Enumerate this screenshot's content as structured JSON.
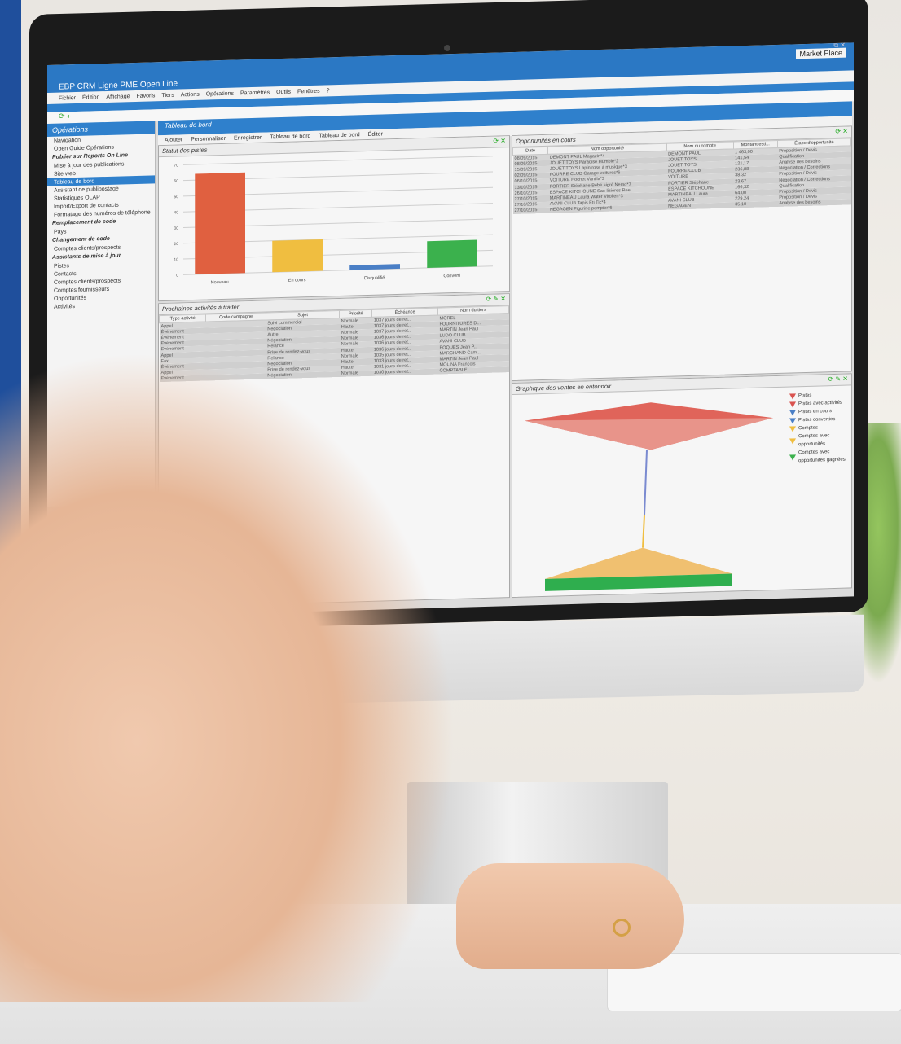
{
  "window": {
    "title": "EBP CRM Ligne PME Open Line",
    "market_place": "Market Place",
    "controls": "_ ⧉ ✕"
  },
  "menu": [
    "Fichier",
    "Édition",
    "Affichage",
    "Favoris",
    "Tiers",
    "Actions",
    "Opérations",
    "Paramètres",
    "Outils",
    "Fenêtres",
    "?"
  ],
  "sidebar": {
    "title": "Opérations",
    "section": "Navigation",
    "items": [
      {
        "label": "Open Guide Opérations",
        "type": "item"
      },
      {
        "label": "Publier sur Reports On Line",
        "type": "group"
      },
      {
        "label": "Mise à jour des publications",
        "type": "item"
      },
      {
        "label": "Site web",
        "type": "item"
      },
      {
        "label": "Tableau de bord",
        "type": "selected"
      },
      {
        "label": "Assistant de publipostage",
        "type": "item"
      },
      {
        "label": "Statistiques OLAP",
        "type": "item"
      },
      {
        "label": "Import/Export de contacts",
        "type": "item"
      },
      {
        "label": "Formatage des numéros de téléphone",
        "type": "item"
      },
      {
        "label": "Remplacement de code",
        "type": "group"
      },
      {
        "label": "Pays",
        "type": "item"
      },
      {
        "label": "Changement de code",
        "type": "group"
      },
      {
        "label": "Comptes clients/prospects",
        "type": "item"
      },
      {
        "label": "Assistants de mise à jour",
        "type": "group"
      },
      {
        "label": "Pistes",
        "type": "item"
      },
      {
        "label": "Contacts",
        "type": "item"
      },
      {
        "label": "Comptes clients/prospects",
        "type": "item"
      },
      {
        "label": "Comptes fournisseurs",
        "type": "item"
      },
      {
        "label": "Opportunités",
        "type": "item"
      },
      {
        "label": "Activités",
        "type": "item"
      }
    ]
  },
  "dashboard": {
    "tab": "Tableau de bord",
    "tools": [
      "Ajouter",
      "Personnaliser",
      "Enregistrer",
      "Tableau de bord",
      "Tableau de bord",
      "Éditer"
    ]
  },
  "chart_data": {
    "type": "bar",
    "title": "Statut des pistes",
    "categories": [
      "Nouveau",
      "En cours",
      "Disqualifié",
      "Converti"
    ],
    "values": [
      64,
      20,
      3,
      17
    ],
    "ylim": [
      0,
      70
    ],
    "yticks": [
      0,
      10,
      20,
      30,
      40,
      50,
      60,
      70
    ],
    "colors": [
      "#e06040",
      "#f0be40",
      "#4a7fc6",
      "#3bb14d"
    ],
    "grid": true
  },
  "activities": {
    "title": "Prochaines activités à traiter",
    "columns": [
      "Type activité",
      "Code campagne",
      "Sujet",
      "Priorité",
      "Échéance",
      "Nom du tiers"
    ],
    "rows": [
      [
        "Appel",
        "",
        "Suivi commercial",
        "Normale",
        "1037 jours de ret...",
        "MOREL"
      ],
      [
        "Événement",
        "",
        "Négociation",
        "Haute",
        "1037 jours de ret...",
        "FOURNITURES D..."
      ],
      [
        "Événement",
        "",
        "Autre",
        "Normale",
        "1037 jours de ret...",
        "MARTIN Jean Paul"
      ],
      [
        "Événement",
        "",
        "Négociation",
        "Normale",
        "1036 jours de ret...",
        "LUDO CLUB"
      ],
      [
        "Événement",
        "",
        "Relance",
        "Normale",
        "1036 jours de ret...",
        "AVANI CLUB"
      ],
      [
        "Appel",
        "",
        "Prise de rendez-vous",
        "Haute",
        "1036 jours de ret...",
        "BOQUES Jean P..."
      ],
      [
        "Fax",
        "",
        "Relance",
        "Normale",
        "1035 jours de ret...",
        "MARCHAND Cam..."
      ],
      [
        "Événement",
        "",
        "Négociation",
        "Haute",
        "1033 jours de ret...",
        "MARTIN Jean Paul"
      ],
      [
        "Appel",
        "",
        "Prise de rendez-vous",
        "Haute",
        "1031 jours de ret...",
        "MOLINA François"
      ],
      [
        "Événement",
        "",
        "Négociation",
        "Normale",
        "1030 jours de ret...",
        "COMPTABLE"
      ]
    ]
  },
  "opportunities": {
    "title": "Opportunités en cours",
    "columns": [
      "Date",
      "Nom opportunité",
      "Nom du compte",
      "Montant esti...",
      "Étape d'opportunité"
    ],
    "rows": [
      [
        "08/09/2015",
        "DEMONT PAUL Magazin*4",
        "DEMONT PAUL",
        "1 463,00",
        "Proposition / Devis"
      ],
      [
        "08/09/2015",
        "JOUET TOYS Paradise Humble*2",
        "JOUET TOYS",
        "141,54",
        "Qualification"
      ],
      [
        "15/09/2015",
        "JOUET TOYS Lapin rose à musique*3",
        "JOUET TOYS",
        "121,17",
        "Analyse des besoins"
      ],
      [
        "02/09/2015",
        "FOURRE CLUB Garage voitures*6",
        "FOURRE CLUB",
        "236,88",
        "Négociation / Corrections"
      ],
      [
        "06/10/2015",
        "VOITURE Hochet Vanilla*3",
        "VOITURE",
        "38,32",
        "Proposition / Devis"
      ],
      [
        "13/10/2015",
        "FORTIER Stéphane Bébé sigré Nemo*7",
        "FORTIER Stéphane",
        "23,67",
        "Négociation / Corrections"
      ],
      [
        "26/10/2015",
        "ESPACE KITCHOUNE Sac-liziéres Ree...",
        "ESPACE KITCHOUNE",
        "166,32",
        "Qualification"
      ],
      [
        "27/10/2015",
        "MARTINEAU Laura Water Vitolien*3",
        "MARTINEAU Laura",
        "64,00",
        "Proposition / Devis"
      ],
      [
        "27/10/2015",
        "AVANI CLUB Tapis Éti Tic*4",
        "AVANI CLUB",
        "229,24",
        "Proposition / Devis"
      ],
      [
        "27/10/2015",
        "NEGAGEN Figurine pompier*6",
        "NEGAGEN",
        "35,10",
        "Analyse des besoins"
      ]
    ]
  },
  "funnel": {
    "title": "Graphique des ventes en entonnoir",
    "legend": [
      {
        "label": "Pistes",
        "color": "#d9534f"
      },
      {
        "label": "Pistes avec activités",
        "color": "#d9534f"
      },
      {
        "label": "Pistes en cours",
        "color": "#4a7fc6"
      },
      {
        "label": "Pistes converties",
        "color": "#4a7fc6"
      },
      {
        "label": "Comptes",
        "color": "#f0be40"
      },
      {
        "label": "Comptes avec opportunités",
        "color": "#f0be40"
      },
      {
        "label": "Comptes avec opportunités gagnées",
        "color": "#3bb14d"
      }
    ]
  }
}
